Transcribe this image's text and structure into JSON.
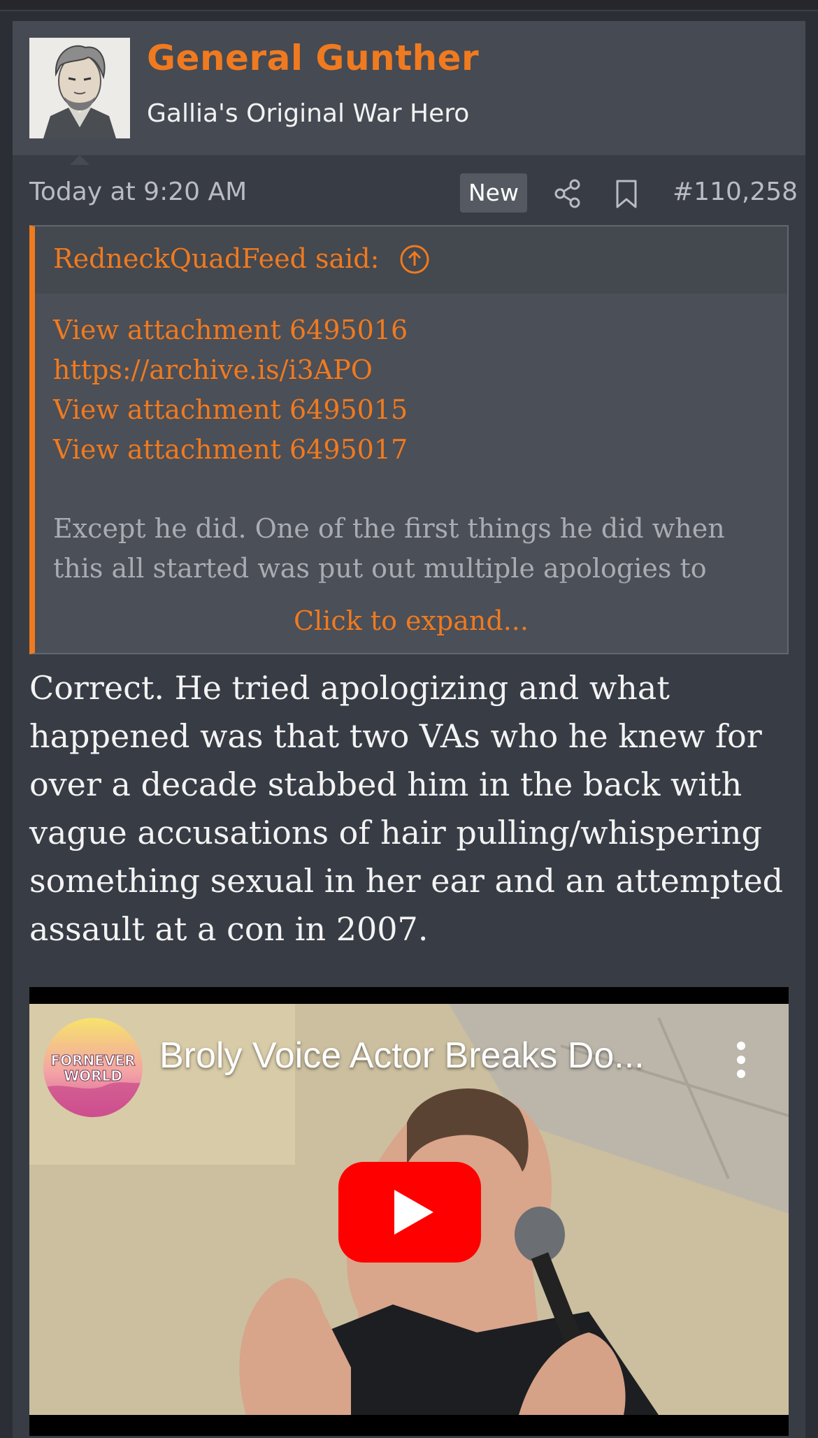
{
  "post": {
    "username": "General Gunther",
    "user_title": "Gallia's Original War Hero",
    "timestamp": "Today at 9:20 AM",
    "new_badge": "New",
    "post_number": "#110,258"
  },
  "quote": {
    "author": "RedneckQuadFeed said:",
    "links": [
      "View attachment 6495016",
      "https://archive.is/i3APO",
      "View attachment 6495015",
      "View attachment 6495017"
    ],
    "text": "Except he did. One of the first things he did when this all started was put out multiple apologies to",
    "expand_label": "Click to expand..."
  },
  "message": {
    "text": "Correct. He tried apologizing and what happened was that two VAs who he knew for over a decade stabbed him in the back with vague accusations of hair pulling/whispering something sexual in her ear and an attempted assault at a con in 2007."
  },
  "video": {
    "title": "Broly Voice Actor Breaks Do...",
    "channel_logo_line1": "FORNEVER",
    "channel_logo_line2": "WORLD"
  },
  "colors": {
    "accent": "#f07a1f",
    "youtube_red": "#ff0000"
  },
  "icons": [
    "share-icon",
    "bookmark-icon",
    "arrow-up-circle-icon",
    "more-vertical-icon",
    "play-icon"
  ]
}
